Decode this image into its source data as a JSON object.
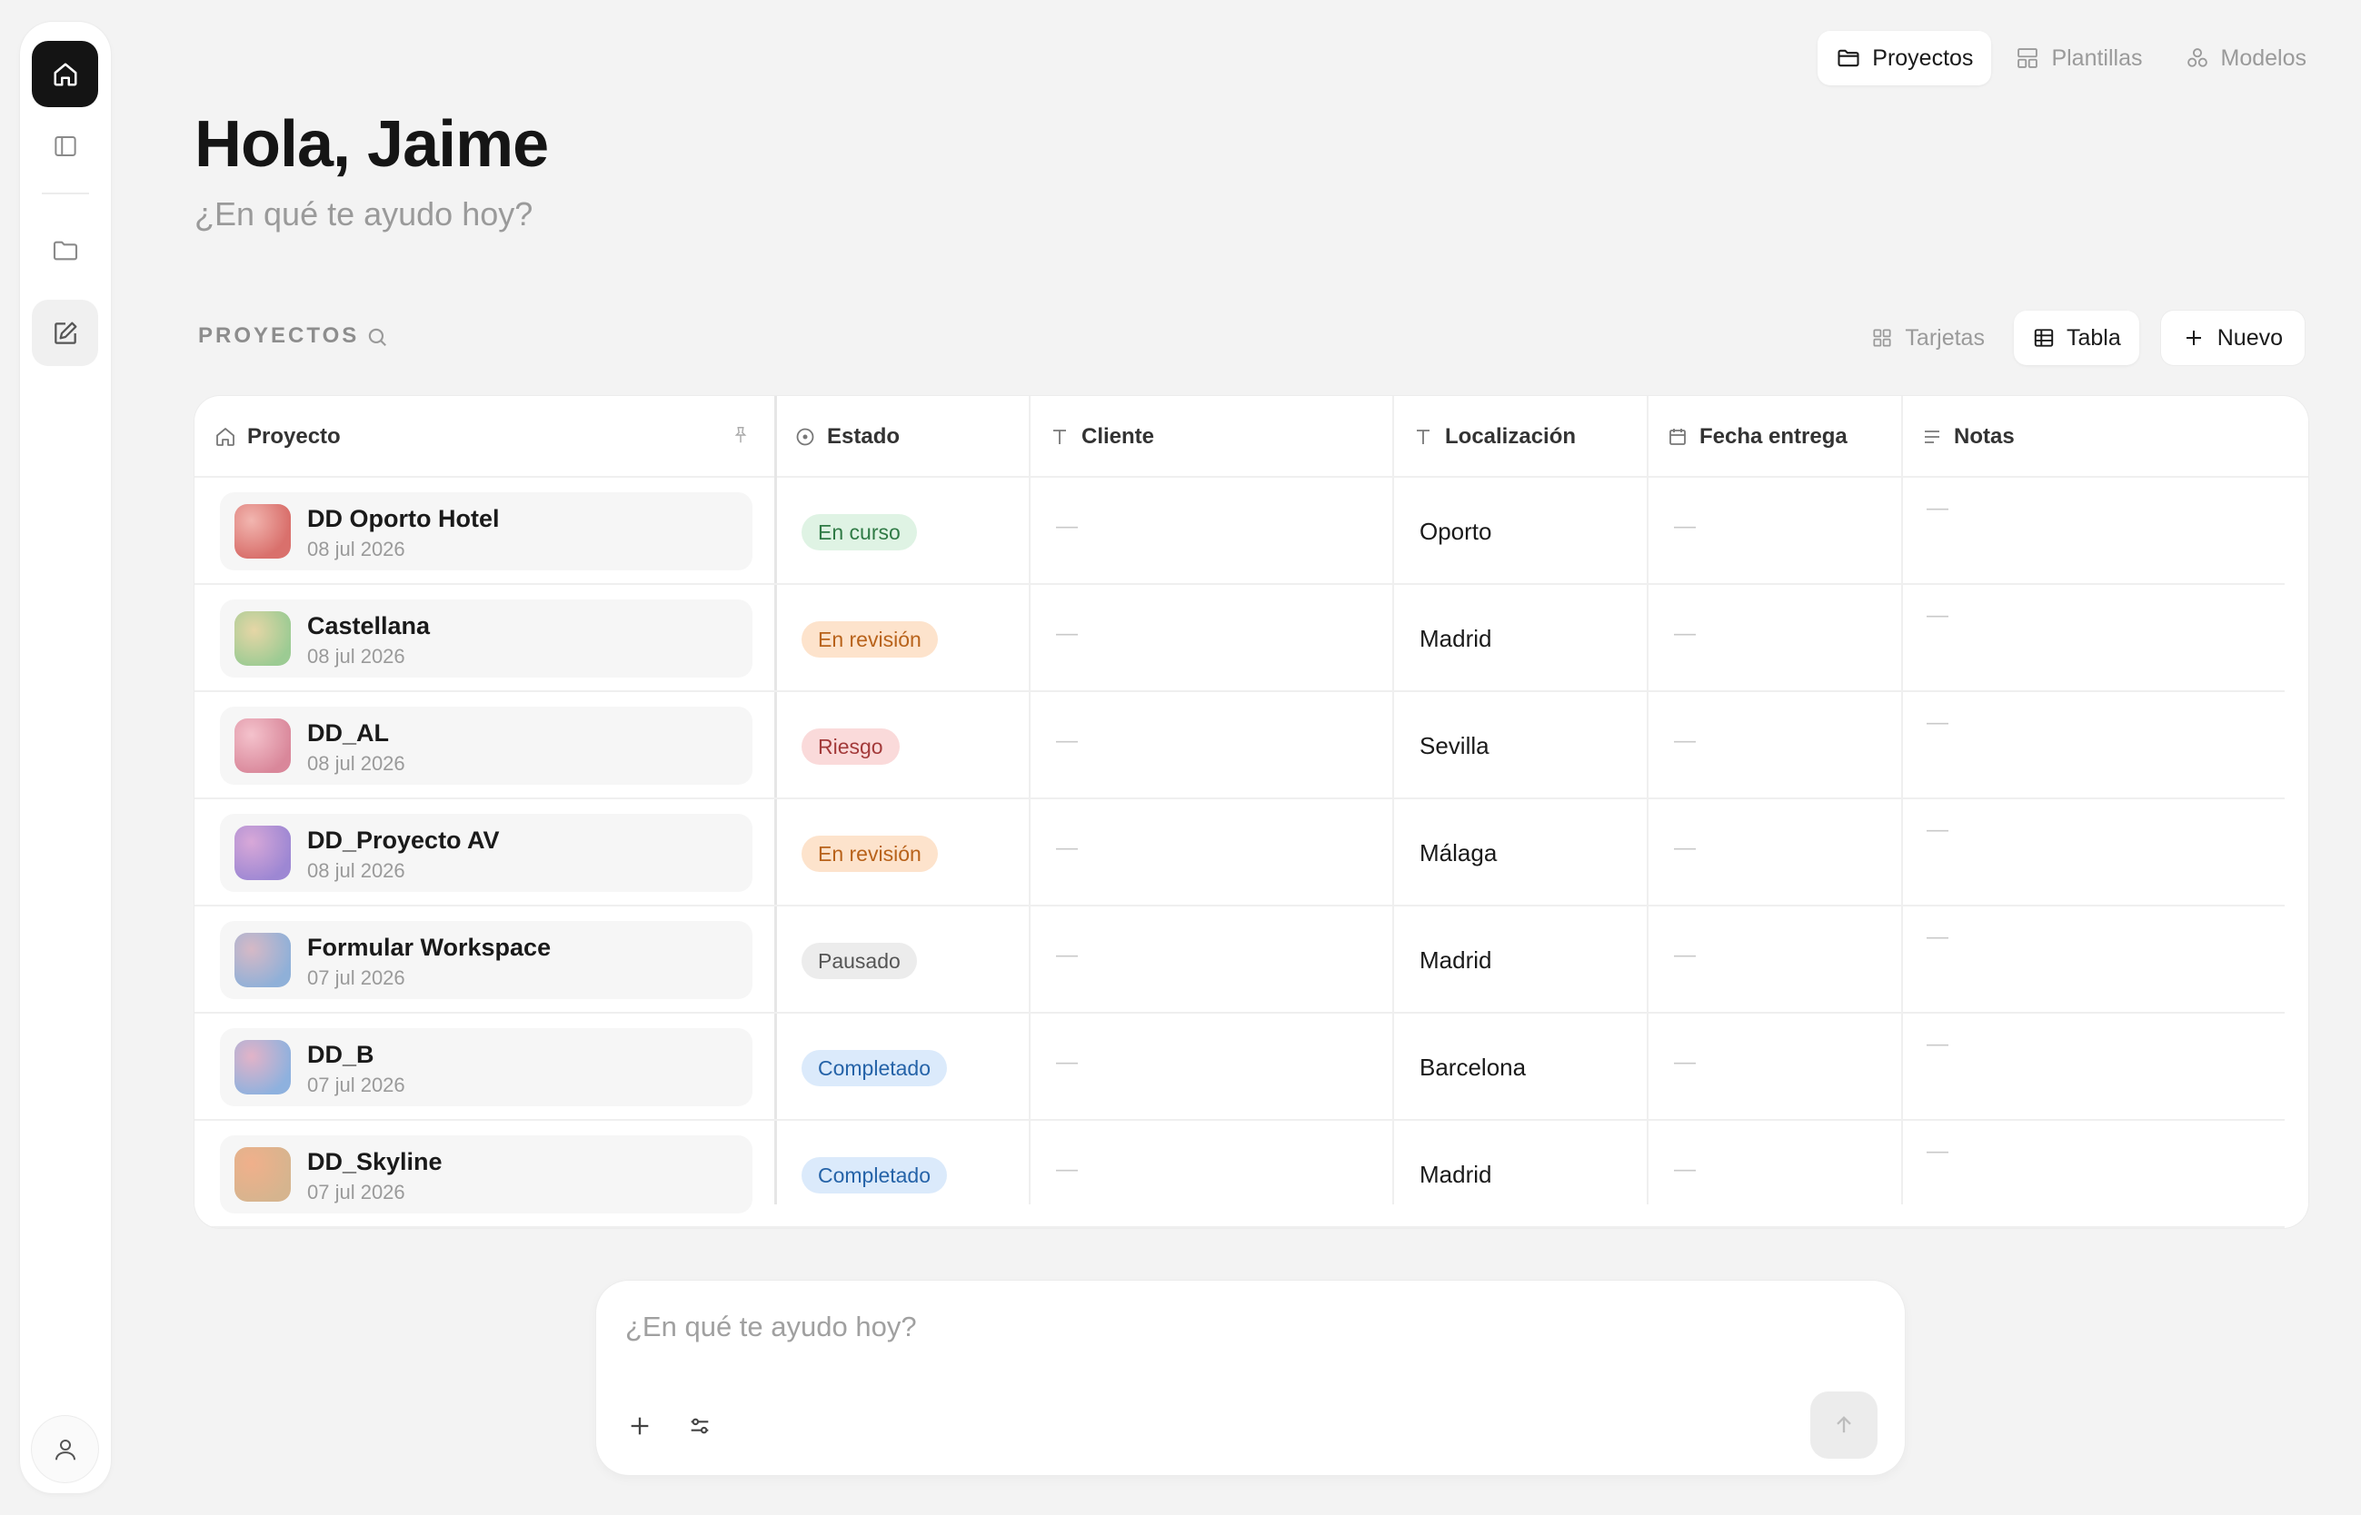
{
  "topnav": {
    "items": [
      {
        "label": "Proyectos",
        "icon": "folder-icon",
        "active": true
      },
      {
        "label": "Plantillas",
        "icon": "template-icon",
        "active": false
      },
      {
        "label": "Modelos",
        "icon": "models-icon",
        "active": false
      }
    ]
  },
  "greeting": {
    "title": "Hola, Jaime",
    "subtitle": "¿En qué te ayudo hoy?"
  },
  "section": {
    "label": "PROYECTOS",
    "views": [
      {
        "label": "Tarjetas",
        "active": false
      },
      {
        "label": "Tabla",
        "active": true
      }
    ],
    "new_label": "Nuevo"
  },
  "table": {
    "columns": [
      "Proyecto",
      "Estado",
      "Cliente",
      "Localización",
      "Fecha entrega",
      "Notas"
    ],
    "empty": "—",
    "rows": [
      {
        "name": "DD Oporto Hotel",
        "date": "08 jul 2026",
        "status": "En curso",
        "location": "Oporto"
      },
      {
        "name": "Castellana",
        "date": "08 jul 2026",
        "status": "En revisión",
        "location": "Madrid"
      },
      {
        "name": "DD_AL",
        "date": "08 jul 2026",
        "status": "Riesgo",
        "location": "Sevilla"
      },
      {
        "name": "DD_Proyecto AV",
        "date": "08 jul 2026",
        "status": "En revisión",
        "location": "Málaga"
      },
      {
        "name": "Formular Workspace",
        "date": "07 jul 2026",
        "status": "Pausado",
        "location": "Madrid"
      },
      {
        "name": "DD_B",
        "date": "07 jul 2026",
        "status": "Completado",
        "location": "Barcelona"
      },
      {
        "name": "DD_Skyline",
        "date": "07 jul 2026",
        "status": "Completado",
        "location": "Madrid"
      }
    ]
  },
  "status_colors": {
    "En curso": {
      "bg": "#dff3e4",
      "fg": "#2f7a45"
    },
    "En revisión": {
      "bg": "#fde3cc",
      "fg": "#b8621a"
    },
    "Riesgo": {
      "bg": "#fadada",
      "fg": "#a33a3a"
    },
    "Pausado": {
      "bg": "#ececec",
      "fg": "#555555"
    },
    "Completado": {
      "bg": "#dbeafb",
      "fg": "#2563a8"
    }
  },
  "composer": {
    "placeholder": "¿En qué te ayudo hoy?"
  }
}
